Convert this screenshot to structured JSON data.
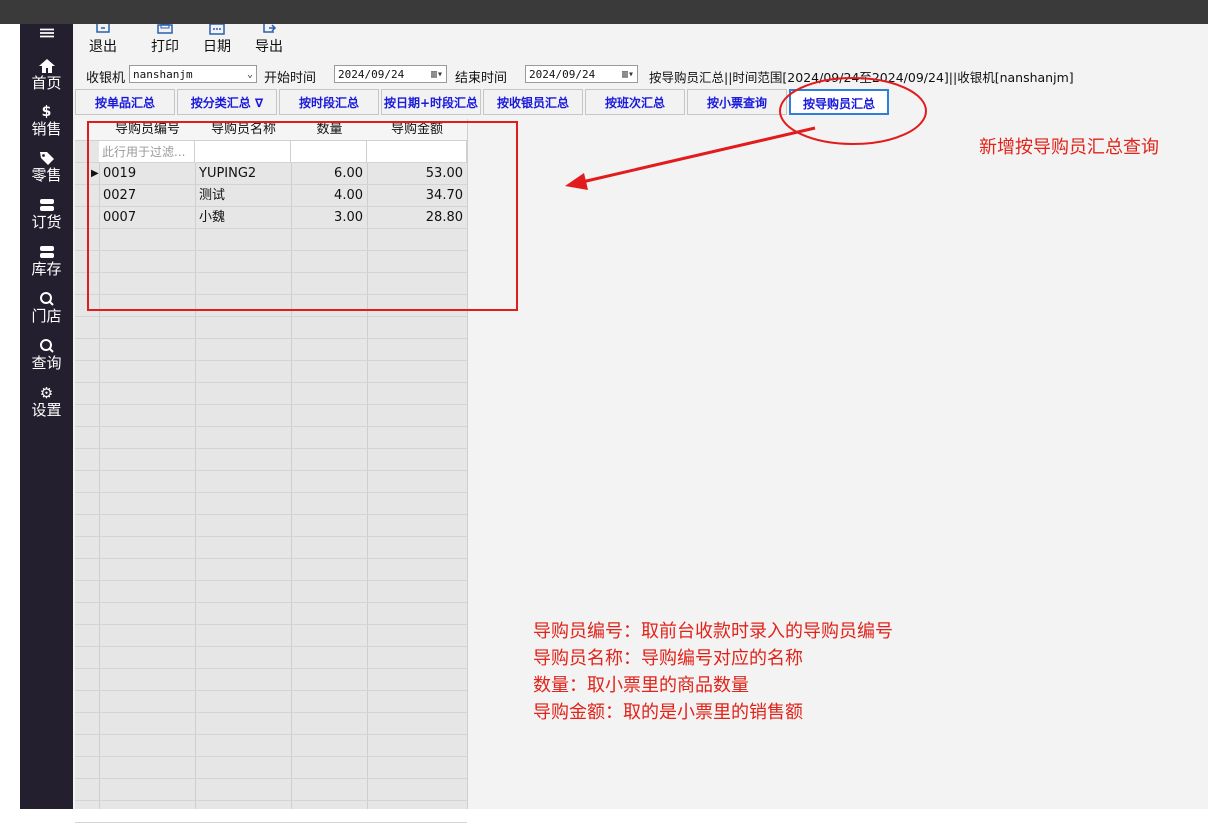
{
  "sidebar": {
    "items": [
      {
        "icon": "menu-icon",
        "label": ""
      },
      {
        "icon": "home-icon",
        "label": "首页"
      },
      {
        "icon": "dollar-icon",
        "label": "销售"
      },
      {
        "icon": "tag-icon",
        "label": "零售"
      },
      {
        "icon": "database-icon",
        "label": "订货"
      },
      {
        "icon": "database-icon",
        "label": "库存"
      },
      {
        "icon": "search-icon",
        "label": "门店"
      },
      {
        "icon": "search-icon",
        "label": "查询"
      },
      {
        "icon": "gear-icon",
        "label": "设置"
      }
    ]
  },
  "toolbar": {
    "exit": "退出",
    "print": "打印",
    "date": "日期",
    "export": "导出"
  },
  "filter": {
    "cashier_label": "收银机",
    "cashier_value": "nanshanjm",
    "start_label": "开始时间",
    "start_value": "2024/09/24",
    "end_label": "结束时间",
    "end_value": "2024/09/24",
    "summary": "按导购员汇总||时间范围[2024/09/24至2024/09/24]||收银机[nanshanjm]"
  },
  "tabs": [
    {
      "label": "按单品汇总"
    },
    {
      "label": "按分类汇总 ∇"
    },
    {
      "label": "按时段汇总"
    },
    {
      "label": "按日期+时段汇总"
    },
    {
      "label": "按收银员汇总"
    },
    {
      "label": "按班次汇总"
    },
    {
      "label": "按小票查询"
    },
    {
      "label": "按导购员汇总"
    }
  ],
  "table": {
    "headers": [
      "导购员编号",
      "导购员名称",
      "数量",
      "导购金额"
    ],
    "filter_placeholder": "此行用于过滤...",
    "rows": [
      {
        "code": "0019",
        "name": "YUPING2",
        "qty": "6.00",
        "amount": "53.00"
      },
      {
        "code": "0027",
        "name": "测试",
        "qty": "4.00",
        "amount": "34.70"
      },
      {
        "code": "0007",
        "name": "小魏",
        "qty": "3.00",
        "amount": "28.80"
      }
    ]
  },
  "annotations": {
    "callout": "新增按导购员汇总查询",
    "notes": [
      "导购员编号：取前台收款时录入的导购员编号",
      "导购员名称：导购编号对应的名称",
      "数量：取小票里的商品数量",
      "导购金额：取的是小票里的销售额"
    ],
    "color": "#e2231a"
  }
}
